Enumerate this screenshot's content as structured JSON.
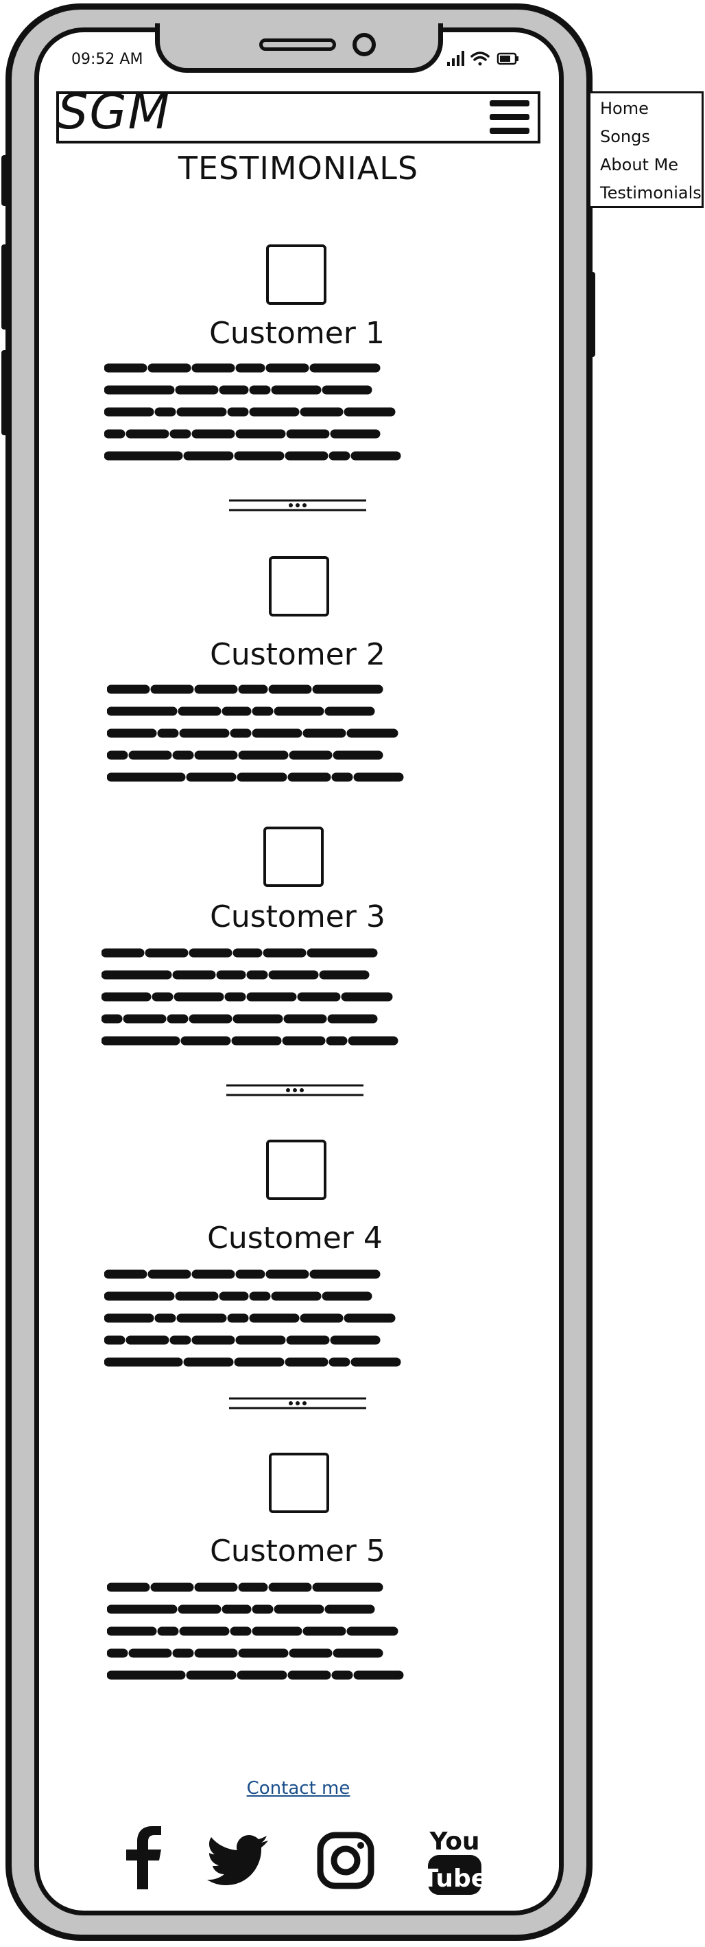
{
  "status_bar": {
    "time": "09:52 AM",
    "icons": [
      "signal-icon",
      "wifi-icon",
      "battery-icon"
    ]
  },
  "header": {
    "logo": "SGM",
    "menu_icon": "hamburger-icon"
  },
  "nav": {
    "items": [
      {
        "label": "Home"
      },
      {
        "label": "Songs"
      },
      {
        "label": "About Me"
      },
      {
        "label": "Testimonials"
      }
    ]
  },
  "page": {
    "title": "TESTIMONIALS"
  },
  "testimonials": [
    {
      "name": "Customer 1"
    },
    {
      "name": "Customer 2"
    },
    {
      "name": "Customer 3"
    },
    {
      "name": "Customer 4"
    },
    {
      "name": "Customer 5"
    }
  ],
  "footer": {
    "contact_label": "Contact me",
    "social": [
      "facebook-icon",
      "twitter-icon",
      "instagram-icon",
      "youtube-icon"
    ],
    "youtube_text": [
      "You",
      "Tube"
    ]
  },
  "colors": {
    "frame": "#c4c4c4",
    "ink": "#111111",
    "link": "#1a4f8b"
  }
}
